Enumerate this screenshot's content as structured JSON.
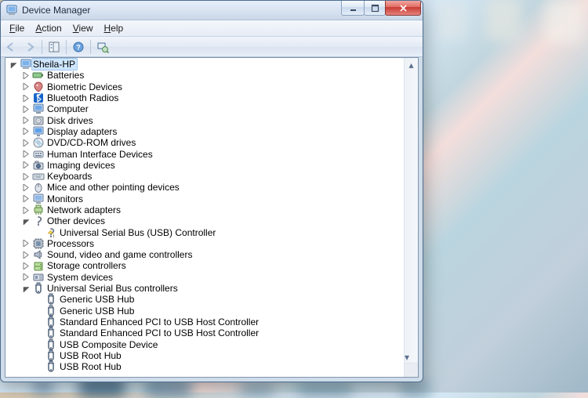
{
  "window": {
    "title": "Device Manager"
  },
  "menus": {
    "file": "File",
    "action": "Action",
    "view": "View",
    "help": "Help"
  },
  "root": "Sheila-HP",
  "categories": [
    {
      "label": "Batteries",
      "icon": "battery",
      "expanded": false
    },
    {
      "label": "Biometric Devices",
      "icon": "biometric",
      "expanded": false
    },
    {
      "label": "Bluetooth Radios",
      "icon": "bluetooth",
      "expanded": false
    },
    {
      "label": "Computer",
      "icon": "computer",
      "expanded": false
    },
    {
      "label": "Disk drives",
      "icon": "disk",
      "expanded": false
    },
    {
      "label": "Display adapters",
      "icon": "display",
      "expanded": false
    },
    {
      "label": "DVD/CD-ROM drives",
      "icon": "optical",
      "expanded": false
    },
    {
      "label": "Human Interface Devices",
      "icon": "hid",
      "expanded": false
    },
    {
      "label": "Imaging devices",
      "icon": "camera",
      "expanded": false
    },
    {
      "label": "Keyboards",
      "icon": "keyboard",
      "expanded": false
    },
    {
      "label": "Mice and other pointing devices",
      "icon": "mouse",
      "expanded": false
    },
    {
      "label": "Monitors",
      "icon": "monitor",
      "expanded": false
    },
    {
      "label": "Network adapters",
      "icon": "network",
      "expanded": false
    },
    {
      "label": "Other devices",
      "icon": "unknown",
      "expanded": true,
      "children": [
        {
          "label": "Universal Serial Bus (USB) Controller",
          "icon": "unknown-warn"
        }
      ]
    },
    {
      "label": "Processors",
      "icon": "cpu",
      "expanded": false
    },
    {
      "label": "Sound, video and game controllers",
      "icon": "sound",
      "expanded": false
    },
    {
      "label": "Storage controllers",
      "icon": "storage",
      "expanded": false
    },
    {
      "label": "System devices",
      "icon": "system",
      "expanded": false
    },
    {
      "label": "Universal Serial Bus controllers",
      "icon": "usb",
      "expanded": true,
      "children": [
        {
          "label": "Generic USB Hub",
          "icon": "usb"
        },
        {
          "label": "Generic USB Hub",
          "icon": "usb"
        },
        {
          "label": "Standard Enhanced PCI to USB Host Controller",
          "icon": "usb"
        },
        {
          "label": "Standard Enhanced PCI to USB Host Controller",
          "icon": "usb"
        },
        {
          "label": "USB Composite Device",
          "icon": "usb"
        },
        {
          "label": "USB Root Hub",
          "icon": "usb"
        },
        {
          "label": "USB Root Hub",
          "icon": "usb"
        }
      ]
    }
  ]
}
